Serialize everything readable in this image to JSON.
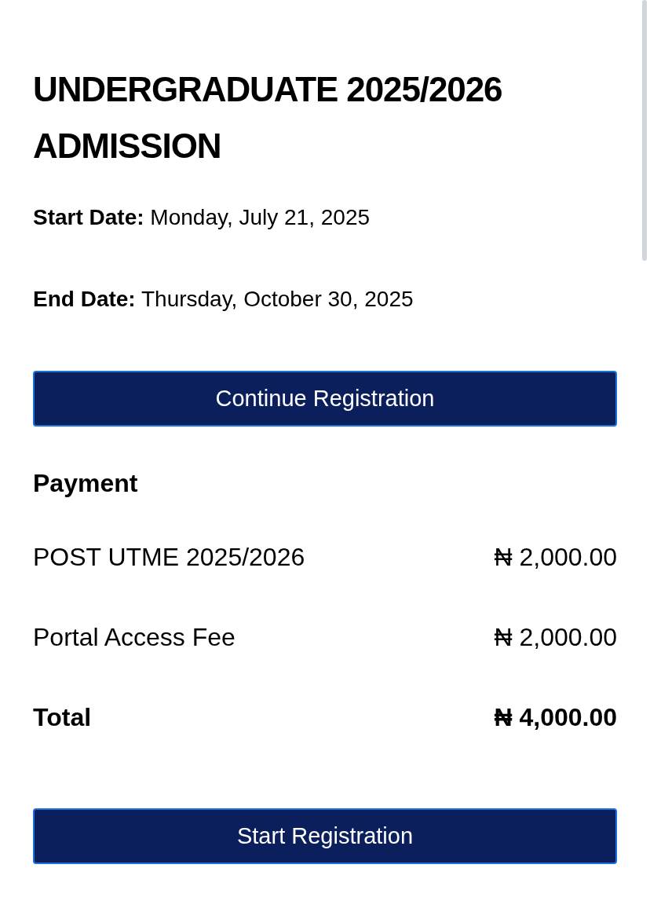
{
  "title": "UNDERGRADUATE 2025/2026 ADMISSION",
  "dates": [
    {
      "label": "Start Date:",
      "value": "Monday, July 21, 2025"
    },
    {
      "label": "End Date:",
      "value": "Thursday, October 30, 2025"
    }
  ],
  "continue_button": "Continue Registration",
  "payment": {
    "heading": "Payment",
    "items": [
      {
        "kind": "line",
        "name": "POST UTME 2025/2026",
        "amount": "₦ 2,000.00"
      },
      {
        "kind": "line",
        "name": "Portal Access Fee",
        "amount": "₦ 2,000.00"
      },
      {
        "kind": "total",
        "name": "Total",
        "amount": "₦ 4,000.00"
      }
    ]
  },
  "start_button": "Start Registration"
}
